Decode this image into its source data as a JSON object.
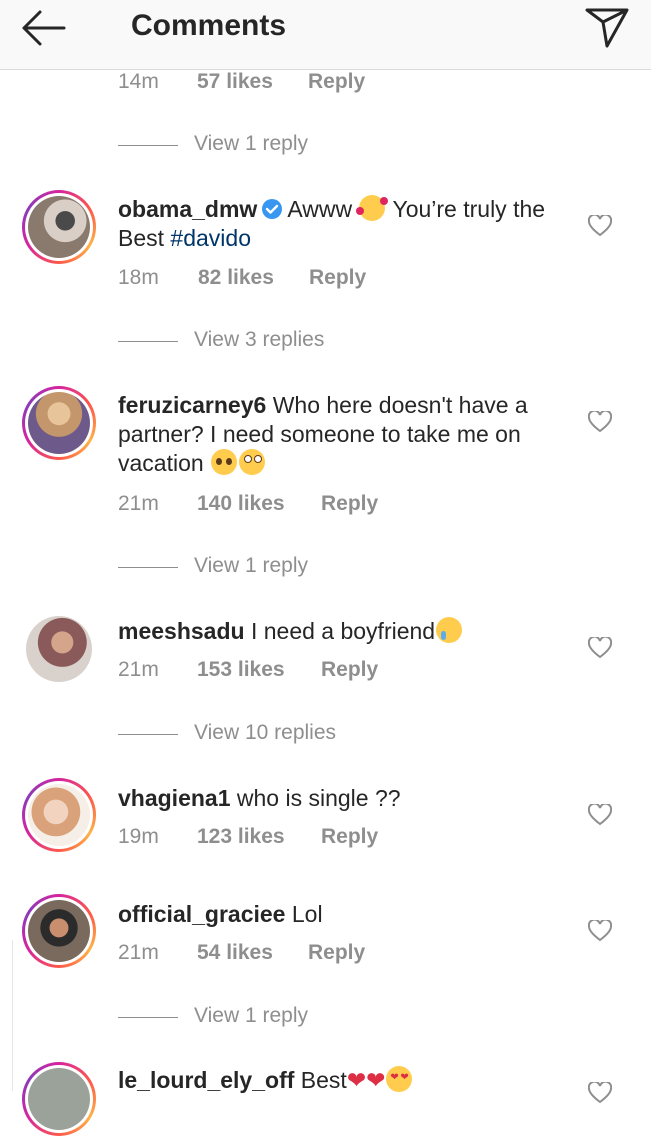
{
  "header": {
    "title": "Comments"
  },
  "top_meta": {
    "time": "14m",
    "likes": "57 likes",
    "reply": "Reply"
  },
  "view_replies": [
    "View 1 reply",
    "View 3 replies",
    "View 1 reply",
    "View 10 replies",
    "View 1 reply"
  ],
  "comments": [
    {
      "username": "obama_dmw",
      "verified": true,
      "text_before": "Awww",
      "text_after": "You’re truly the Best ",
      "hashtag": "#davido",
      "time": "18m",
      "likes": "82 likes",
      "reply": "Reply",
      "emojis": [
        "smiling-face-with-hearts-emoji"
      ]
    },
    {
      "username": "feruzicarney6",
      "text": "Who here doesn't have a partner? I need someone to take me on vacation",
      "time": "21m",
      "likes": "140 likes",
      "reply": "Reply",
      "emojis": [
        "pleading-face-emoji",
        "eye-roll-emoji"
      ]
    },
    {
      "username": "meeshsadu",
      "text": "I need a boyfriend",
      "time": "21m",
      "likes": "153 likes",
      "reply": "Reply",
      "emojis": [
        "crying-face-emoji"
      ]
    },
    {
      "username": "vhagiena1",
      "text": "who is single ??",
      "time": "19m",
      "likes": "123 likes",
      "reply": "Reply"
    },
    {
      "username": "official_graciee",
      "text": "Lol",
      "time": "21m",
      "likes": "54 likes",
      "reply": "Reply"
    },
    {
      "username": "le_lourd_ely_off",
      "text": "Best",
      "emojis": [
        "red-heart-emoji",
        "red-heart-emoji",
        "heart-eyes-emoji"
      ]
    }
  ],
  "colors": {
    "text": "#262626",
    "meta": "#8e8e8e",
    "hashtag": "#003569",
    "verified": "#3897f0",
    "header_bg": "#f9f9f9"
  }
}
